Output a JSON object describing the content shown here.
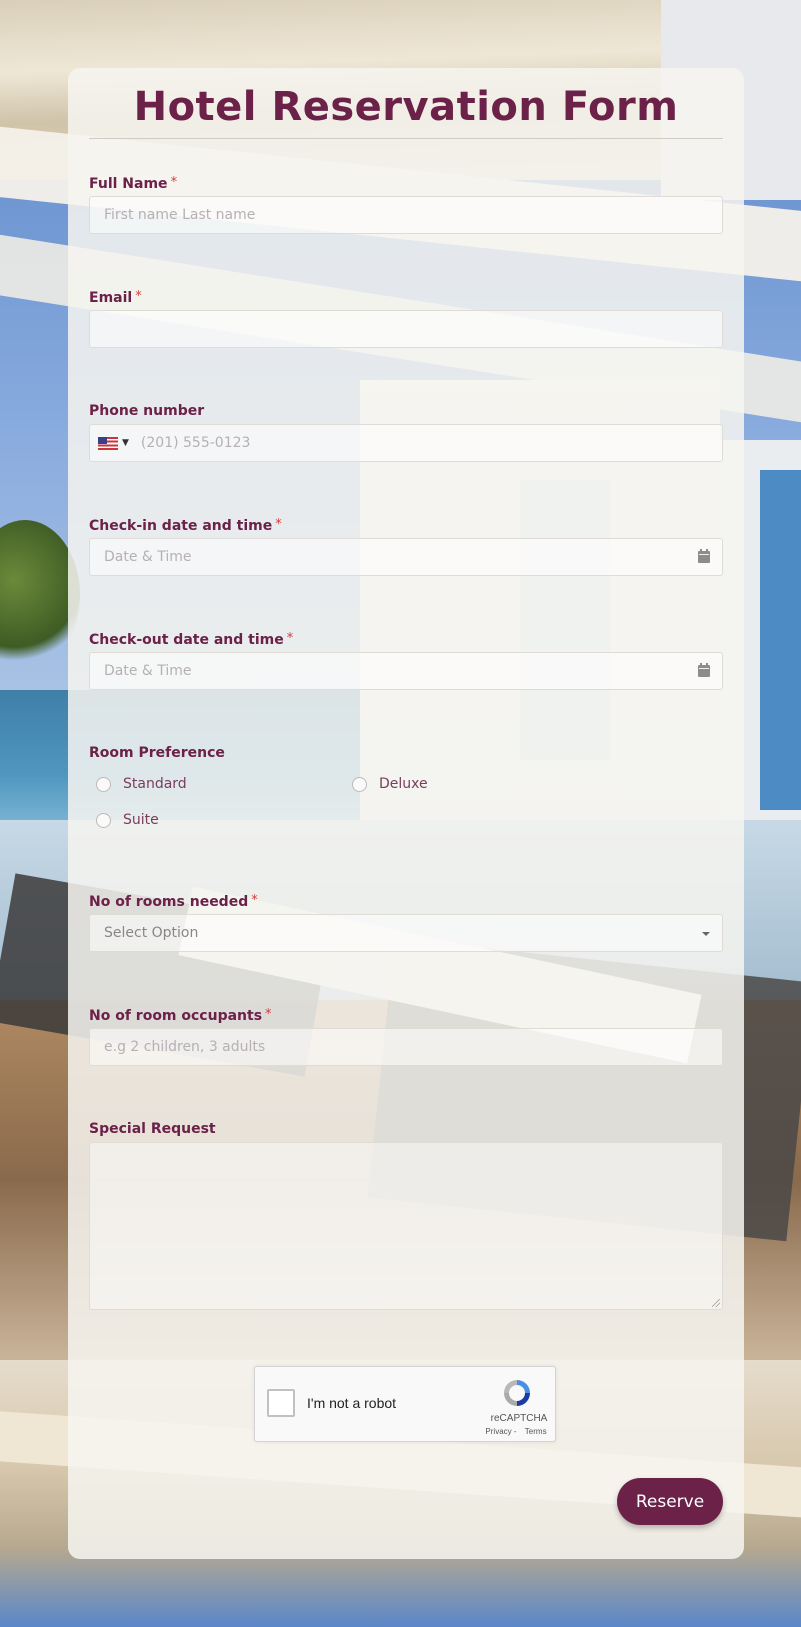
{
  "form": {
    "title": "Hotel Reservation Form",
    "required_mark": "*",
    "accent_color": "#6b2148"
  },
  "fields": {
    "full_name": {
      "label": "Full Name",
      "placeholder": "First name Last name",
      "required": true
    },
    "email": {
      "label": "Email",
      "placeholder": "",
      "required": true
    },
    "phone": {
      "label": "Phone number",
      "placeholder": "(201) 555-0123",
      "country_flag": "us-flag-icon",
      "required": false
    },
    "checkin": {
      "label": "Check-in date and time",
      "placeholder": "Date & Time",
      "icon": "calendar-icon",
      "required": true
    },
    "checkout": {
      "label": "Check-out date and time",
      "placeholder": "Date & Time",
      "icon": "calendar-icon",
      "required": true
    },
    "room_preference": {
      "label": "Room Preference",
      "options": [
        "Standard",
        "Deluxe",
        "Suite"
      ],
      "required": false
    },
    "rooms_needed": {
      "label": "No of rooms needed",
      "selected": "Select Option",
      "required": true
    },
    "occupants": {
      "label": "No of room occupants",
      "placeholder": "e.g 2 children, 3 adults",
      "required": true
    },
    "special_request": {
      "label": "Special Request",
      "value": "",
      "required": false
    }
  },
  "recaptcha": {
    "checkbox_label": "I'm not a robot",
    "brand": "reCAPTCHA",
    "privacy": "Privacy",
    "separator": "-",
    "terms": "Terms"
  },
  "submit": {
    "label": "Reserve"
  }
}
